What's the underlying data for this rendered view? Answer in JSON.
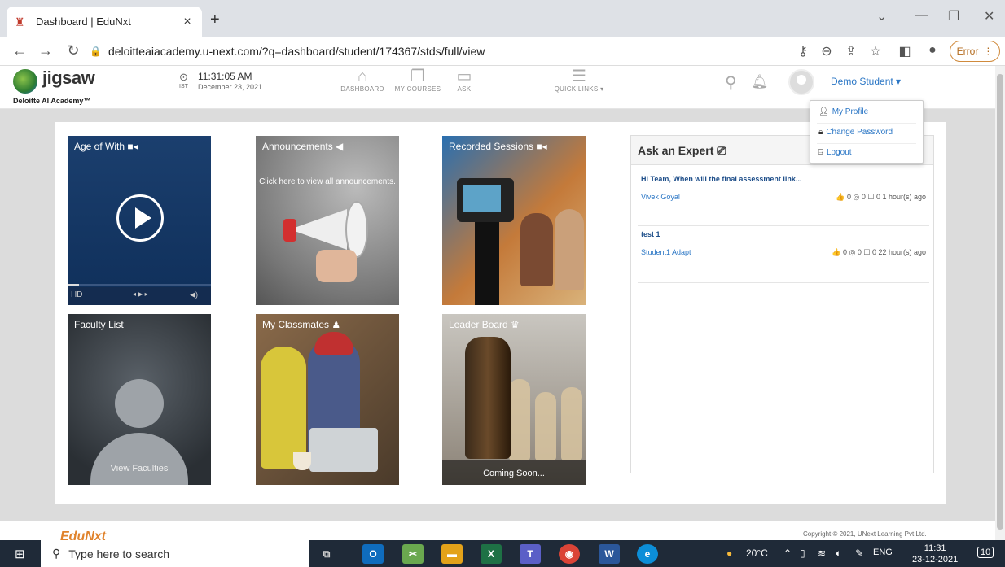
{
  "browser": {
    "tab_title": "Dashboard | EduNxt",
    "url": "deloitteaiacademy.u-next.com/?q=dashboard/student/174367/stds/full/view",
    "error_label": "Error"
  },
  "header": {
    "logo_text": "jigsaw",
    "logo_sub": "Deloitte AI Academy™",
    "tz": "IST",
    "time": "11:31:05 AM",
    "date": "December 23, 2021",
    "nav": [
      {
        "label": "DASHBOARD",
        "icon": "home-icon"
      },
      {
        "label": "MY COURSES",
        "icon": "copy-icon"
      },
      {
        "label": "ASK",
        "icon": "chat-icon"
      },
      {
        "label": "QUICK LINKS ▾",
        "icon": "list-icon"
      }
    ],
    "user_name": "Demo Student ▾"
  },
  "user_menu": {
    "items": [
      {
        "label": "My Profile",
        "icon": "user-icon"
      },
      {
        "label": "Change Password",
        "icon": "lock-icon"
      },
      {
        "label": "Logout",
        "icon": "logout-icon"
      }
    ]
  },
  "tiles": {
    "age_of_with": {
      "title": "Age of With ■◂",
      "hd": "HD",
      "controls": "◂ ▶ ▸",
      "volume": "◀)"
    },
    "announcements": {
      "title": "Announcements ◀",
      "cta": "Click here to view all announcements."
    },
    "recorded_sessions": {
      "title": "Recorded Sessions ■◂"
    },
    "faculty_list": {
      "title": "Faculty List",
      "caption": "View Faculties"
    },
    "my_classmates": {
      "title": "My Classmates ♟"
    },
    "leader_board": {
      "title": "Leader Board ♛",
      "caption": "Coming Soon..."
    }
  },
  "ask_expert": {
    "title": "Ask an Expert ⎚",
    "questions": [
      {
        "text": "Hi Team, When will the final assessment link...",
        "author": "Vivek Goyal",
        "stats": "👍 0  ◎ 0  ☐ 0  1 hour(s) ago"
      },
      {
        "text": "test 1",
        "author": "Student1 Adapt",
        "stats": "👍 0  ◎ 0  ☐ 0  22 hour(s) ago"
      }
    ]
  },
  "footer": {
    "logo": "EduNxt",
    "copyright": "Copyright © 2021, UNext Learning Pvt Ltd."
  },
  "taskbar": {
    "search_placeholder": "Type here to search",
    "weather": "20°C",
    "lang": "ENG",
    "time": "11:31",
    "date": "23-12-2021",
    "notif_count": "10"
  }
}
